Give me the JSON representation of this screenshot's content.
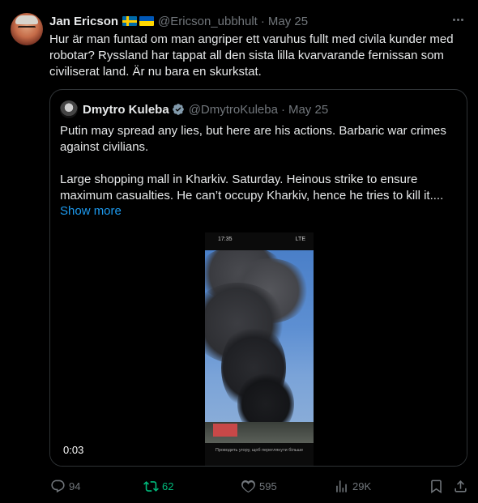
{
  "tweet": {
    "author_name": "Jan Ericson",
    "handle": "@Ericson_ubbhult",
    "separator": "·",
    "date": "May 25",
    "text": "Hur är man funtad om man angriper ett varuhus fullt med civila kunder med robotar? Ryssland har tappat all den sista lilla kvarvarande fernissan som civiliserat land. Är nu bara en skurkstat.",
    "flags": [
      "sweden-flag",
      "ukraine-flag"
    ]
  },
  "quote": {
    "author_name": "Dmytro Kuleba",
    "handle": "@DmytroKuleba",
    "separator": "·",
    "date": "May 25",
    "paragraph1": "Putin may spread any lies, but here are his actions. Barbaric war crimes against civilians.",
    "paragraph2": "Large shopping mall in Kharkiv. Saturday. Heinous strike to ensure maximum casualties. He can’t occupy Kharkiv, hence he tries to kill it....",
    "show_more": "Show more",
    "video": {
      "duration": "0:03",
      "phone_time": "17:35",
      "phone_status": "LTE",
      "caption": "Проводить угору, щоб переглянути більше"
    }
  },
  "actions": {
    "replies": "94",
    "retweets": "62",
    "likes": "595",
    "views": "29K"
  },
  "colors": {
    "background": "#000000",
    "text": "#e7e9ea",
    "muted": "#71767b",
    "link": "#1d9bf0",
    "retweet_active": "#00ba7c",
    "border": "#2f3336"
  }
}
